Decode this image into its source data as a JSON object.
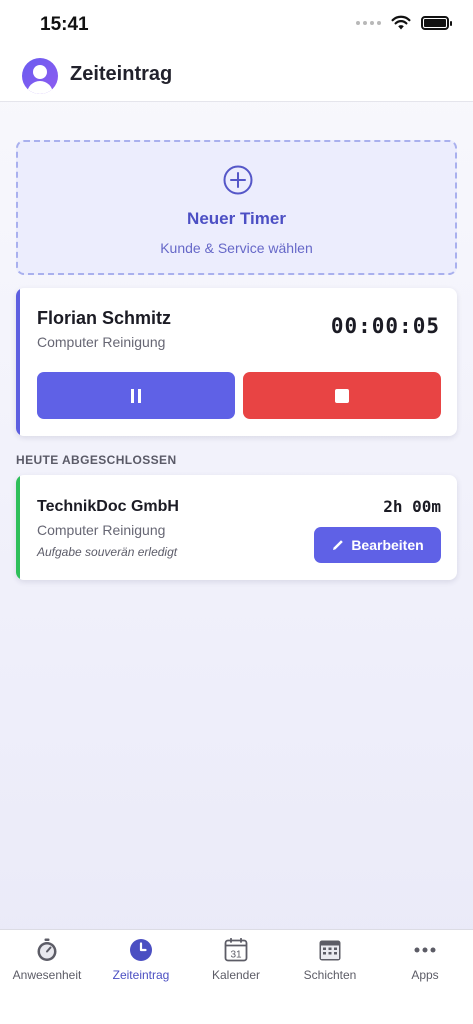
{
  "status_bar": {
    "time": "15:41"
  },
  "header": {
    "title": "Zeiteintrag"
  },
  "new_timer": {
    "title": "Neuer Timer",
    "subtitle": "Kunde & Service wählen"
  },
  "active_timer": {
    "client": "Florian Schmitz",
    "service": "Computer Reinigung",
    "elapsed": "00:00:05",
    "pause_icon": "pause-icon",
    "stop_icon": "stop-icon"
  },
  "completed_section": {
    "label": "HEUTE ABGESCHLOSSEN",
    "entries": [
      {
        "client": "TechnikDoc GmbH",
        "service": "Computer Reinigung",
        "note": "Aufgabe souverän erledigt",
        "duration": "2h 00m",
        "edit_label": "Bearbeiten"
      }
    ]
  },
  "tab_bar": {
    "active": "Zeiteintrag",
    "tabs": [
      {
        "label": "Anwesenheit",
        "icon": "stopwatch-icon"
      },
      {
        "label": "Zeiteintrag",
        "icon": "clock-icon"
      },
      {
        "label": "Kalender",
        "icon": "calendar-icon",
        "calendar_day": "31"
      },
      {
        "label": "Schichten",
        "icon": "schedule-grid-icon"
      },
      {
        "label": "Apps",
        "icon": "more-icon"
      }
    ]
  },
  "colors": {
    "accent": "#5f61e6",
    "stop": "#e84444",
    "completed_accent": "#2fbf5a"
  }
}
